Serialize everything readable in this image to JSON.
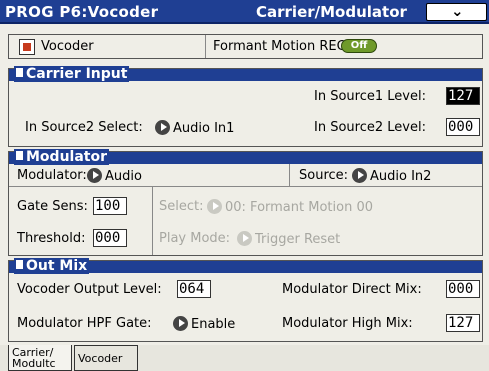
{
  "header": {
    "program": "PROG P6:Vocoder",
    "page": "Carrier/Modulator",
    "menu_icon": "chevron-down-icon"
  },
  "top": {
    "vocoder_label": "Vocoder",
    "vocoder_checked": true,
    "formant_label": "Formant Motion REC",
    "formant_value": "Off"
  },
  "carrier": {
    "title": "Carrier Input",
    "src1_level_label": "In Source1 Level:",
    "src1_level_value": "127",
    "src2_select_label": "In Source2 Select:",
    "src2_select_value": "Audio In1",
    "src2_level_label": "In Source2 Level:",
    "src2_level_value": "000"
  },
  "modulator": {
    "title": "Modulator",
    "modulator_label": "Modulator:",
    "modulator_value": "Audio",
    "source_label": "Source:",
    "source_value": "Audio In2",
    "gate_sens_label": "Gate Sens:",
    "gate_sens_value": "100",
    "select_label": "Select:",
    "select_value": "00: Formant Motion 00",
    "threshold_label": "Threshold:",
    "threshold_value": "000",
    "play_mode_label": "Play Mode:",
    "play_mode_value": "Trigger Reset"
  },
  "outmix": {
    "title": "Out Mix",
    "output_level_label": "Vocoder Output Level:",
    "output_level_value": "064",
    "direct_mix_label": "Modulator Direct Mix:",
    "direct_mix_value": "000",
    "hpf_gate_label": "Modulator HPF Gate:",
    "hpf_gate_value": "Enable",
    "high_mix_label": "Modulator High Mix:",
    "high_mix_value": "127"
  },
  "tabs": [
    {
      "label": "Carrier/\nModultc"
    },
    {
      "label": "Vocoder"
    }
  ],
  "colors": {
    "title_bar": "#1f3f93",
    "panel": "#efeee7",
    "switch_on": "#6f9a2a",
    "checkbox_mark": "#c63a1d"
  }
}
